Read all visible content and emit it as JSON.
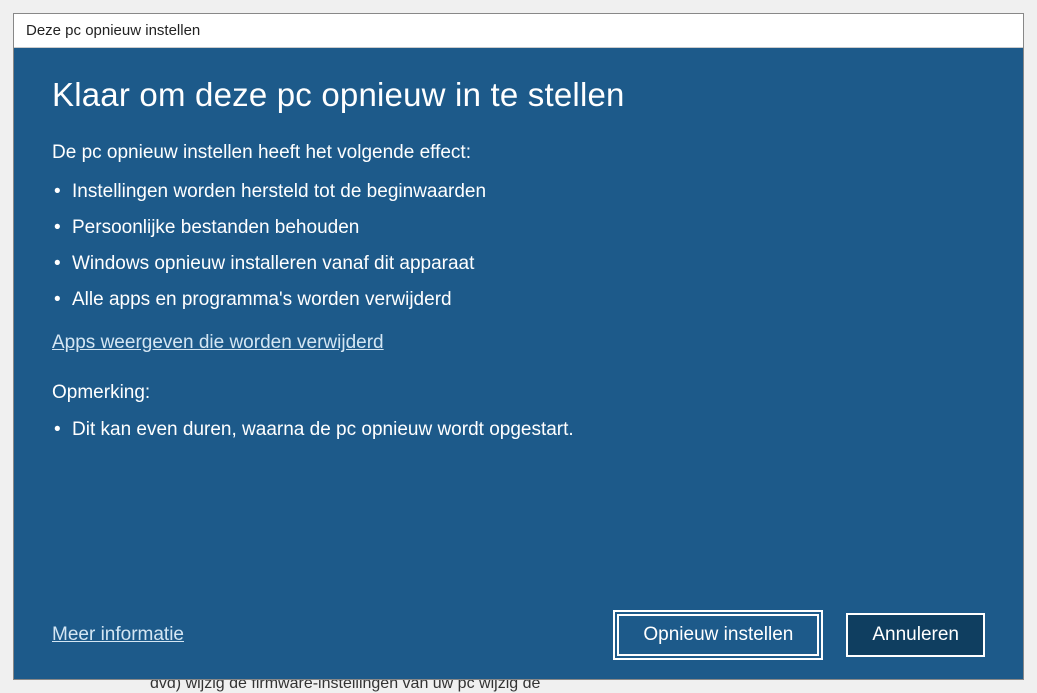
{
  "window": {
    "title": "Deze pc opnieuw instellen"
  },
  "main": {
    "heading": "Klaar om deze pc opnieuw in te stellen",
    "intro": "De pc opnieuw instellen heeft het volgende effect:",
    "effects": [
      "Instellingen worden hersteld tot de beginwaarden",
      "Persoonlijke bestanden behouden",
      "Windows opnieuw installeren vanaf dit apparaat",
      "Alle apps en programma's worden verwijderd"
    ],
    "apps_link": "Apps weergeven die worden verwijderd",
    "note_label": "Opmerking:",
    "notes": [
      "Dit kan even duren, waarna de pc opnieuw wordt opgestart."
    ]
  },
  "footer": {
    "more_info": "Meer informatie",
    "reset_button": "Opnieuw instellen",
    "cancel_button": "Annuleren"
  },
  "background": {
    "bottom_text": "dvd)  wijzig de firmware-instellingen van uw pc  wijzig de"
  }
}
